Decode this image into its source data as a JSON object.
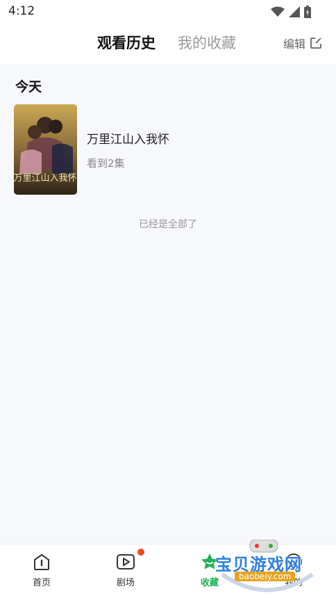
{
  "status_bar": {
    "time": "4:12"
  },
  "header": {
    "tabs": [
      {
        "label": "观看历史",
        "active": true
      },
      {
        "label": "我的收藏",
        "active": false
      }
    ],
    "edit_label": "编辑"
  },
  "main": {
    "section_title": "今天",
    "items": [
      {
        "title": "万里江山入我怀",
        "progress": "看到2集",
        "poster_text": "万里江山入我怀"
      }
    ],
    "end_hint": "已经是全部了"
  },
  "bottom_nav": {
    "items": [
      {
        "label": "首页",
        "icon": "home-icon"
      },
      {
        "label": "剧场",
        "icon": "play-icon"
      },
      {
        "label": "收藏",
        "icon": "star-icon",
        "active": true
      },
      {
        "label": "我的",
        "icon": "user-icon"
      }
    ]
  },
  "watermark": {
    "text": "宝贝游戏网",
    "url": "baobeiy.com"
  },
  "colors": {
    "active_green": "#1eb157",
    "badge_red": "#f14a1e",
    "background": "#f7f8fc"
  }
}
